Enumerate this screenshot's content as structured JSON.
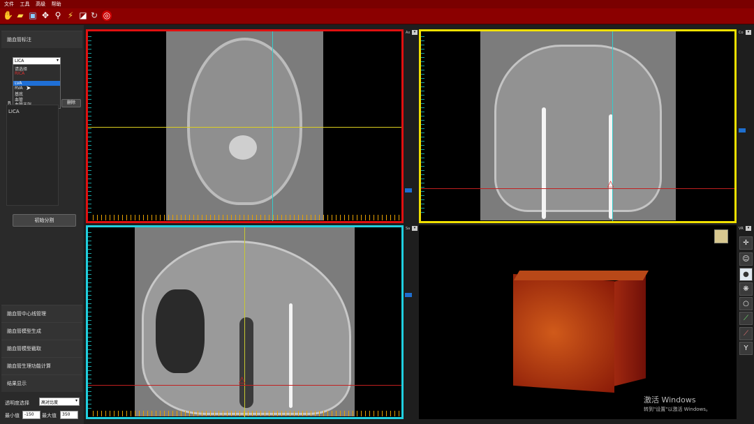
{
  "menu": [
    "文件",
    "工具",
    "高级",
    "帮助"
  ],
  "toolbar_icons": [
    "folder-open-icon",
    "save-icon",
    "move-icon",
    "zoom-icon",
    "wand-icon",
    "contrast-icon",
    "rotate-icon",
    "reset-icon"
  ],
  "sidebar": {
    "section_title": "脑血管标注",
    "vessel_select_value": "LICA",
    "dropdown_options": [
      "请选择",
      "RICA",
      "LVA",
      "RVA",
      "基底",
      "血管",
      "血管末端"
    ],
    "selected_option": "LVA",
    "r_label": "R",
    "delete_button": "删除",
    "list_items": [
      "LICA"
    ],
    "init_button": "初始分割",
    "panels": [
      "脑血管中心线管理",
      "脑血管模型生成",
      "脑血管模型截取",
      "脑血管生理功能计算",
      "结果显示"
    ],
    "transparency_label": "透明度选择",
    "transparency_value": "高对比度",
    "min_label": "最小值",
    "min_value": "-150",
    "max_label": "最大值",
    "max_value": "350"
  },
  "views": {
    "axial_label": "Ax",
    "coronal_label": "Co",
    "sagittal_label": "Sa",
    "volume_label": "VR"
  },
  "watermark": {
    "line1": "激活 Windows",
    "line2": "转到\"设置\"以激活 Windows。"
  },
  "colors": {
    "axial_border": "#e01010",
    "coronal_border": "#f0e000",
    "sagittal_border": "#20d0e0",
    "toolbar": "#8b0000"
  }
}
